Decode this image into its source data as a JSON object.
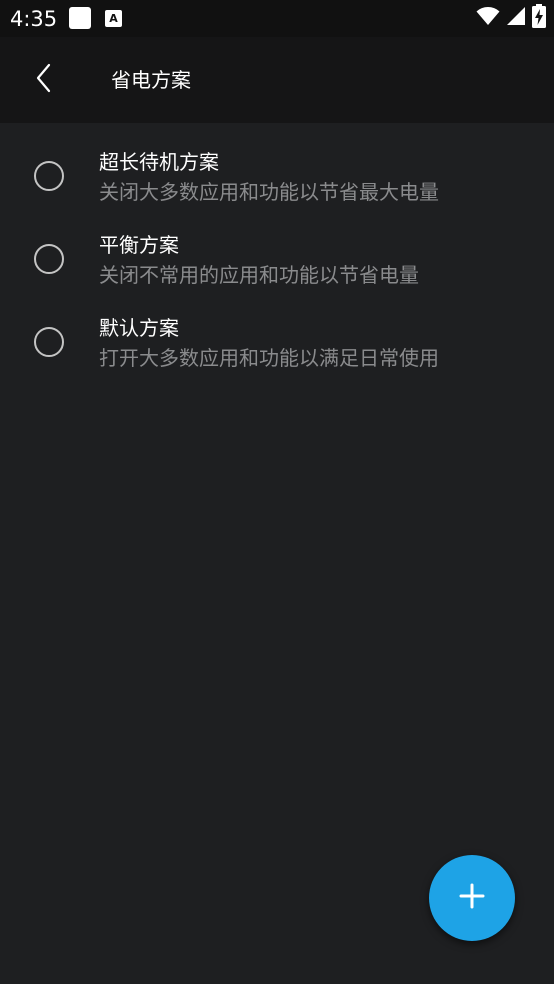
{
  "status_bar": {
    "time": "4:35",
    "a_icon_letter": "A",
    "icons": [
      "notification-square-icon",
      "a-notification-icon",
      "wifi-icon",
      "cell-signal-icon",
      "battery-charging-icon"
    ]
  },
  "toolbar": {
    "back_icon": "chevron-left-icon",
    "title": "省电方案"
  },
  "plans": [
    {
      "title": "超长待机方案",
      "subtitle": "关闭大多数应用和功能以节省最大电量",
      "selected": false
    },
    {
      "title": "平衡方案",
      "subtitle": "关闭不常用的应用和功能以节省电量",
      "selected": false
    },
    {
      "title": "默认方案",
      "subtitle": "打开大多数应用和功能以满足日常使用",
      "selected": false
    }
  ],
  "fab": {
    "icon": "plus-icon"
  },
  "colors": {
    "background": "#1e1f21",
    "toolbar": "#151516",
    "status_bar": "#111111",
    "accent": "#1ea3e6",
    "text_primary": "#ffffff",
    "text_secondary": "#8a8b8d"
  }
}
